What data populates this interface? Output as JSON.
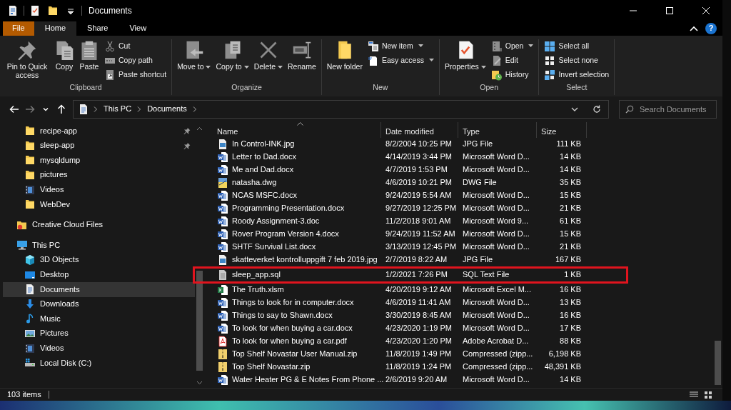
{
  "window": {
    "title": "Documents"
  },
  "ribbon": {
    "tabs": [
      {
        "label": "File",
        "kind": "backstage",
        "selected": false
      },
      {
        "label": "Home",
        "kind": "tab",
        "selected": true
      },
      {
        "label": "Share",
        "kind": "tab",
        "selected": false
      },
      {
        "label": "View",
        "kind": "tab",
        "selected": false
      }
    ],
    "help": "?",
    "groups": [
      {
        "label": "Clipboard",
        "items": [
          {
            "kind": "large",
            "label": "Pin to Quick access",
            "menu": false
          },
          {
            "kind": "large",
            "label": "Copy",
            "menu": false
          },
          {
            "kind": "large",
            "label": "Paste",
            "menu": false
          },
          {
            "kind": "stack",
            "buttons": [
              {
                "label": "Cut",
                "menu": false
              },
              {
                "label": "Copy path",
                "menu": false
              },
              {
                "label": "Paste shortcut",
                "menu": false
              }
            ]
          }
        ]
      },
      {
        "label": "Organize",
        "items": [
          {
            "kind": "large",
            "label": "Move to",
            "menu": true
          },
          {
            "kind": "large",
            "label": "Copy to",
            "menu": true
          },
          {
            "kind": "large",
            "label": "Delete",
            "menu": true
          },
          {
            "kind": "large",
            "label": "Rename",
            "menu": false
          }
        ]
      },
      {
        "label": "New",
        "items": [
          {
            "kind": "large",
            "label": "New folder",
            "menu": false
          },
          {
            "kind": "stack",
            "buttons": [
              {
                "label": "New item",
                "menu": true
              },
              {
                "label": "Easy access",
                "menu": true
              }
            ]
          }
        ]
      },
      {
        "label": "Open",
        "items": [
          {
            "kind": "large",
            "label": "Properties",
            "menu": true
          },
          {
            "kind": "stack",
            "buttons": [
              {
                "label": "Open",
                "menu": true
              },
              {
                "label": "Edit",
                "menu": false
              },
              {
                "label": "History",
                "menu": false
              }
            ]
          }
        ]
      },
      {
        "label": "Select",
        "items": [
          {
            "kind": "stack",
            "buttons": [
              {
                "label": "Select all",
                "menu": false
              },
              {
                "label": "Select none",
                "menu": false
              },
              {
                "label": "Invert selection",
                "menu": false
              }
            ]
          }
        ]
      }
    ]
  },
  "nav": {
    "buttons": [
      {
        "disabled": false
      },
      {
        "disabled": true
      },
      {
        "disabled": false
      },
      {
        "disabled": false
      }
    ],
    "address": {
      "crumbs": [
        "This PC",
        "Documents"
      ]
    },
    "search": {
      "placeholder": "Search Documents"
    }
  },
  "sidebar": {
    "pinned_items": [
      {
        "label": "recipe-app",
        "kind": "folder",
        "pinned": true,
        "selected": false
      },
      {
        "label": "sleep-app",
        "kind": "folder",
        "pinned": true,
        "selected": false
      },
      {
        "label": "mysqldump",
        "kind": "folder",
        "pinned": false,
        "selected": false
      },
      {
        "label": "pictures",
        "kind": "folder",
        "pinned": false,
        "selected": false
      },
      {
        "label": "Videos",
        "kind": "video",
        "pinned": false,
        "selected": false
      },
      {
        "label": "WebDev",
        "kind": "folder",
        "pinned": false,
        "selected": false
      }
    ],
    "items": [
      {
        "label": "Creative Cloud Files",
        "kind": "ccfolder",
        "selected": false
      },
      {
        "label": "This PC",
        "kind": "pc",
        "selected": false,
        "children": [
          {
            "label": "3D Objects",
            "kind": "cube",
            "selected": false
          },
          {
            "label": "Desktop",
            "kind": "desktop",
            "selected": false
          },
          {
            "label": "Documents",
            "kind": "documents",
            "selected": true
          },
          {
            "label": "Downloads",
            "kind": "downloads",
            "selected": false
          },
          {
            "label": "Music",
            "kind": "music",
            "selected": false
          },
          {
            "label": "Pictures",
            "kind": "pictures",
            "selected": false
          },
          {
            "label": "Videos",
            "kind": "video",
            "selected": false
          },
          {
            "label": "Local Disk (C:)",
            "kind": "disk",
            "selected": false
          }
        ]
      }
    ]
  },
  "files": {
    "columns": [
      {
        "label": "Name",
        "sorted": true
      },
      {
        "label": "Date modified",
        "sorted": false
      },
      {
        "label": "Type",
        "sorted": false
      },
      {
        "label": "Size",
        "sorted": false
      }
    ],
    "rows": [
      {
        "name": "In Control-INK.jpg",
        "date": "8/2/2004 10:25 PM",
        "type": "JPG File",
        "size": "111 KB",
        "kind": "jpg",
        "outlined": false
      },
      {
        "name": "Letter to Dad.docx",
        "date": "4/14/2019 3:44 PM",
        "type": "Microsoft Word D...",
        "size": "14 KB",
        "kind": "word",
        "outlined": false
      },
      {
        "name": "Me and Dad.docx",
        "date": "4/7/2019 1:53 PM",
        "type": "Microsoft Word D...",
        "size": "14 KB",
        "kind": "word",
        "outlined": false
      },
      {
        "name": "natasha.dwg",
        "date": "4/6/2019 10:21 PM",
        "type": "DWG File",
        "size": "35 KB",
        "kind": "dwg",
        "outlined": false
      },
      {
        "name": "NCAS MSFC.docx",
        "date": "9/24/2019 5:54 AM",
        "type": "Microsoft Word D...",
        "size": "15 KB",
        "kind": "word",
        "outlined": false
      },
      {
        "name": "Programming Presentation.docx",
        "date": "9/27/2019 12:25 PM",
        "type": "Microsoft Word D...",
        "size": "21 KB",
        "kind": "word",
        "outlined": false
      },
      {
        "name": "Roody Assignment-3.doc",
        "date": "11/2/2018 9:01 AM",
        "type": "Microsoft Word 9...",
        "size": "61 KB",
        "kind": "word",
        "outlined": false
      },
      {
        "name": "Rover Program Version 4.docx",
        "date": "9/24/2019 11:52 AM",
        "type": "Microsoft Word D...",
        "size": "15 KB",
        "kind": "word",
        "outlined": false
      },
      {
        "name": "SHTF Survival List.docx",
        "date": "3/13/2019 12:45 PM",
        "type": "Microsoft Word D...",
        "size": "21 KB",
        "kind": "word",
        "outlined": false
      },
      {
        "name": "skatteverket kontrolluppgift 7 feb 2019.jpg",
        "date": "2/7/2019 8:22 AM",
        "type": "JPG File",
        "size": "167 KB",
        "kind": "jpg",
        "outlined": false
      },
      {
        "name": "sleep_app.sql",
        "date": "1/2/2021 7:26 PM",
        "type": "SQL Text File",
        "size": "1 KB",
        "kind": "sql",
        "outlined": true
      },
      {
        "name": "The Truth.xlsm",
        "date": "4/20/2019 9:12 AM",
        "type": "Microsoft Excel M...",
        "size": "16 KB",
        "kind": "excel",
        "outlined": false
      },
      {
        "name": "Things to look for in computer.docx",
        "date": "4/6/2019 11:41 AM",
        "type": "Microsoft Word D...",
        "size": "13 KB",
        "kind": "word",
        "outlined": false
      },
      {
        "name": "Things to say to Shawn.docx",
        "date": "3/30/2019 8:45 AM",
        "type": "Microsoft Word D...",
        "size": "16 KB",
        "kind": "word",
        "outlined": false
      },
      {
        "name": "To look for when buying a car.docx",
        "date": "4/23/2020 1:19 PM",
        "type": "Microsoft Word D...",
        "size": "17 KB",
        "kind": "word",
        "outlined": false
      },
      {
        "name": "To look for when buying a car.pdf",
        "date": "4/23/2020 1:20 PM",
        "type": "Adobe Acrobat D...",
        "size": "88 KB",
        "kind": "pdf",
        "outlined": false
      },
      {
        "name": "Top Shelf Novastar User Manual.zip",
        "date": "11/8/2019 1:49 PM",
        "type": "Compressed (zipp...",
        "size": "6,198 KB",
        "kind": "zip",
        "outlined": false
      },
      {
        "name": "Top Shelf Novastar.zip",
        "date": "11/8/2019 1:24 PM",
        "type": "Compressed (zipp...",
        "size": "48,391 KB",
        "kind": "zip",
        "outlined": false
      },
      {
        "name": "Water Heater PG & E Notes From Phone ...",
        "date": "2/6/2019 9:20 AM",
        "type": "Microsoft Word D...",
        "size": "14 KB",
        "kind": "word",
        "outlined": false
      }
    ]
  },
  "status_bar": {
    "count": "103 items"
  }
}
